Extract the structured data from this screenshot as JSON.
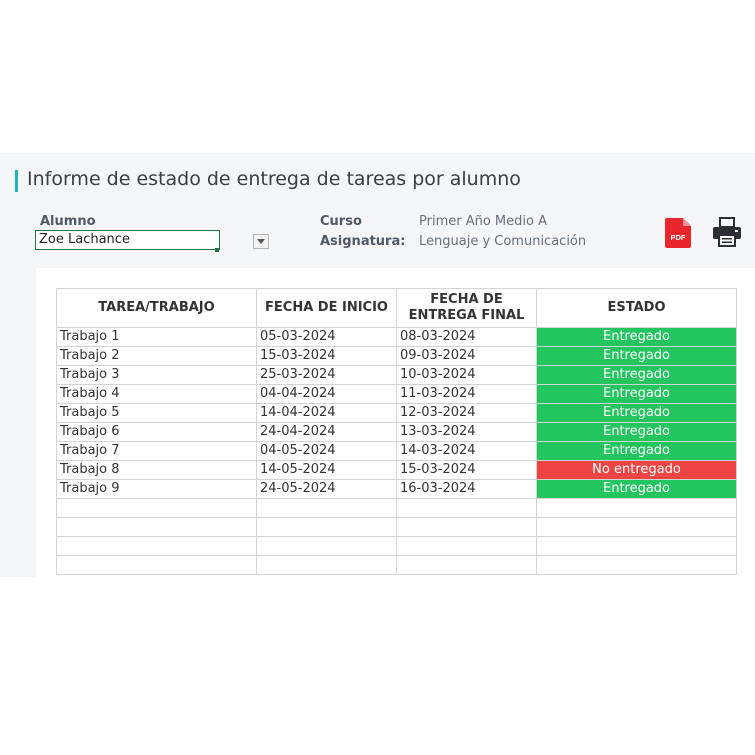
{
  "report": {
    "title": "Informe de estado de entrega de tareas por alumno",
    "student_label": "Alumno",
    "student_value": "Zoe Lachance",
    "course_label": "Curso",
    "course_value": "Primer Año Medio A",
    "subject_label": "Asignatura:",
    "subject_value": "Lenguaje y Comunicación",
    "pdf_icon_text": "PDF"
  },
  "colors": {
    "accent": "#1fb5c7",
    "delivered": "#22c55e",
    "not_delivered": "#ef4444",
    "pdf": "#e8262c"
  },
  "table": {
    "headers": [
      "TAREA/TRABAJO",
      "FECHA DE INICIO",
      "FECHA DE ENTREGA FINAL",
      "ESTADO"
    ],
    "rows": [
      {
        "task": "Trabajo 1",
        "start": "05-03-2024",
        "end": "08-03-2024",
        "status": "Entregado",
        "delivered": true
      },
      {
        "task": "Trabajo 2",
        "start": "15-03-2024",
        "end": "09-03-2024",
        "status": "Entregado",
        "delivered": true
      },
      {
        "task": "Trabajo 3",
        "start": "25-03-2024",
        "end": "10-03-2024",
        "status": "Entregado",
        "delivered": true
      },
      {
        "task": "Trabajo 4",
        "start": "04-04-2024",
        "end": "11-03-2024",
        "status": "Entregado",
        "delivered": true
      },
      {
        "task": "Trabajo 5",
        "start": "14-04-2024",
        "end": "12-03-2024",
        "status": "Entregado",
        "delivered": true
      },
      {
        "task": "Trabajo 6",
        "start": "24-04-2024",
        "end": "13-03-2024",
        "status": "Entregado",
        "delivered": true
      },
      {
        "task": "Trabajo 7",
        "start": "04-05-2024",
        "end": "14-03-2024",
        "status": "Entregado",
        "delivered": true
      },
      {
        "task": "Trabajo 8",
        "start": "14-05-2024",
        "end": "15-03-2024",
        "status": "No entregado",
        "delivered": false
      },
      {
        "task": "Trabajo 9",
        "start": "24-05-2024",
        "end": "16-03-2024",
        "status": "Entregado",
        "delivered": true
      },
      {
        "task": "",
        "start": "",
        "end": "",
        "status": "",
        "delivered": null
      },
      {
        "task": "",
        "start": "",
        "end": "",
        "status": "",
        "delivered": null
      },
      {
        "task": "",
        "start": "",
        "end": "",
        "status": "",
        "delivered": null
      },
      {
        "task": "",
        "start": "",
        "end": "",
        "status": "",
        "delivered": null
      }
    ]
  }
}
